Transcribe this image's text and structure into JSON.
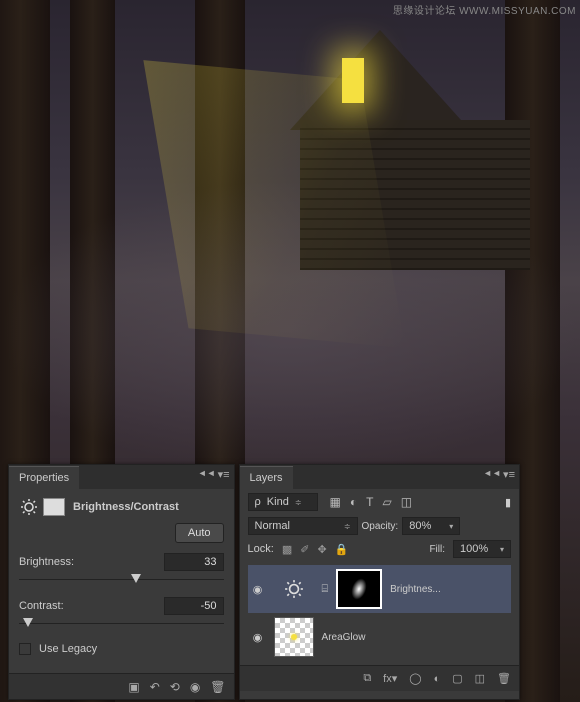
{
  "watermark": "思缘设计论坛  WWW.MISSYUAN.COM",
  "properties": {
    "tab": "Properties",
    "title": "Brightness/Contrast",
    "auto": "Auto",
    "brightness_label": "Brightness:",
    "brightness_value": "33",
    "contrast_label": "Contrast:",
    "contrast_value": "-50",
    "use_legacy": "Use Legacy"
  },
  "layers": {
    "tab": "Layers",
    "kind_label": "Kind",
    "blend_mode": "Normal",
    "opacity_label": "Opacity:",
    "opacity_value": "80%",
    "lock_label": "Lock:",
    "fill_label": "Fill:",
    "fill_value": "100%",
    "items": [
      {
        "name": "Brightnes..."
      },
      {
        "name": "AreaGlow"
      }
    ]
  }
}
